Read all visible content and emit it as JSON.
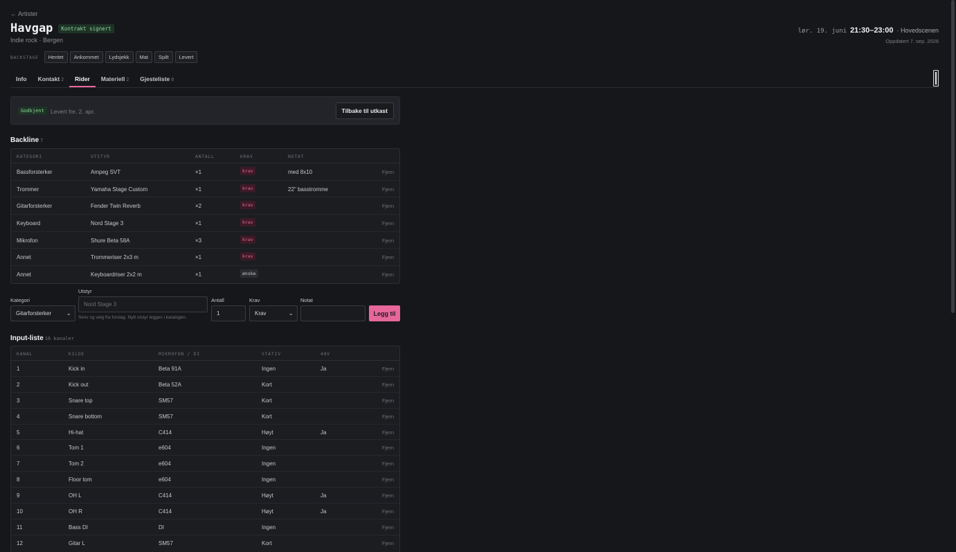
{
  "back": "← Artister",
  "artist": {
    "name": "Havgap",
    "badge": "Kontrakt signert",
    "subtitle": "Indie rock · Bergen"
  },
  "schedule": {
    "day": "lør. 19. juni",
    "time": "21:30–23:00",
    "stage": "· Hovedscenen",
    "updated": "Oppdatert 7. sep. 2026"
  },
  "backstage": {
    "label": "BACKSTAGE",
    "items": [
      "Hentet",
      "Ankommet",
      "Lydsjekk",
      "Mat",
      "Spilt",
      "Levert"
    ]
  },
  "tabs": [
    {
      "label": "Info",
      "count": ""
    },
    {
      "label": "Kontakt",
      "count": "2"
    },
    {
      "label": "Rider",
      "count": ""
    },
    {
      "label": "Materiell",
      "count": "2"
    },
    {
      "label": "Gjesteliste",
      "count": "8"
    }
  ],
  "status": {
    "badge": "Godkjent",
    "text": "Levert fre. 2. apr.",
    "button": "Tilbake til utkast"
  },
  "backline": {
    "title": "Backline",
    "count": "7",
    "headers": [
      "KATEGORI",
      "UTSTYR",
      "ANTALL",
      "KRAV",
      "NOTAT"
    ],
    "remove_label": "Fjern",
    "rows": [
      {
        "kategori": "Bassforsterker",
        "utstyr": "Ampeg SVT",
        "antall": "×1",
        "krav": "krav",
        "notat": "med 8x10"
      },
      {
        "kategori": "Trommer",
        "utstyr": "Yamaha Stage Custom",
        "antall": "×1",
        "krav": "krav",
        "notat": "22\" basstromme"
      },
      {
        "kategori": "Gitarforsterker",
        "utstyr": "Fender Twin Reverb",
        "antall": "×2",
        "krav": "krav",
        "notat": ""
      },
      {
        "kategori": "Keyboard",
        "utstyr": "Nord Stage 3",
        "antall": "×1",
        "krav": "krav",
        "notat": ""
      },
      {
        "kategori": "Mikrofon",
        "utstyr": "Shure Beta 58A",
        "antall": "×3",
        "krav": "krav",
        "notat": ""
      },
      {
        "kategori": "Annet",
        "utstyr": "Trommeriser 2x3 m",
        "antall": "×1",
        "krav": "krav",
        "notat": ""
      },
      {
        "kategori": "Annet",
        "utstyr": "Keyboardriser 2x2 m",
        "antall": "×1",
        "krav": "ønske",
        "notat": ""
      }
    ]
  },
  "form": {
    "kategori_label": "Kategori",
    "kategori_value": "Gitarforsterker",
    "utstyr_label": "Utstyr",
    "utstyr_placeholder": "Nord Stage 3",
    "hint": "Skriv og velg fra forslag. Nytt utstyr legges i katalogen.",
    "antall_label": "Antall",
    "antall_value": "1",
    "krav_label": "Krav",
    "krav_value": "Krav",
    "notat_label": "Notat",
    "notat_value": "",
    "add_button": "Legg til"
  },
  "inputs": {
    "title": "Input-liste",
    "count": "16 kanaler",
    "headers": [
      "KANAL",
      "KILDE",
      "MIKROFON / DI",
      "STATIV",
      "48V"
    ],
    "remove_label": "Fjern",
    "rows": [
      {
        "kanal": "1",
        "kilde": "Kick in",
        "mic": "Beta 91A",
        "stativ": "Ingen",
        "p48": "Ja"
      },
      {
        "kanal": "2",
        "kilde": "Kick out",
        "mic": "Beta 52A",
        "stativ": "Kort",
        "p48": ""
      },
      {
        "kanal": "3",
        "kilde": "Snare top",
        "mic": "SM57",
        "stativ": "Kort",
        "p48": ""
      },
      {
        "kanal": "4",
        "kilde": "Snare bottom",
        "mic": "SM57",
        "stativ": "Kort",
        "p48": ""
      },
      {
        "kanal": "5",
        "kilde": "Hi-hat",
        "mic": "C414",
        "stativ": "Høyt",
        "p48": "Ja"
      },
      {
        "kanal": "6",
        "kilde": "Tom 1",
        "mic": "e604",
        "stativ": "Ingen",
        "p48": ""
      },
      {
        "kanal": "7",
        "kilde": "Tom 2",
        "mic": "e604",
        "stativ": "Ingen",
        "p48": ""
      },
      {
        "kanal": "8",
        "kilde": "Floor tom",
        "mic": "e604",
        "stativ": "Ingen",
        "p48": ""
      },
      {
        "kanal": "9",
        "kilde": "OH L",
        "mic": "C414",
        "stativ": "Høyt",
        "p48": "Ja"
      },
      {
        "kanal": "10",
        "kilde": "OH R",
        "mic": "C414",
        "stativ": "Høyt",
        "p48": "Ja"
      },
      {
        "kanal": "11",
        "kilde": "Bass DI",
        "mic": "DI",
        "stativ": "Ingen",
        "p48": ""
      },
      {
        "kanal": "12",
        "kilde": "Gitar L",
        "mic": "SM57",
        "stativ": "Kort",
        "p48": ""
      }
    ]
  }
}
